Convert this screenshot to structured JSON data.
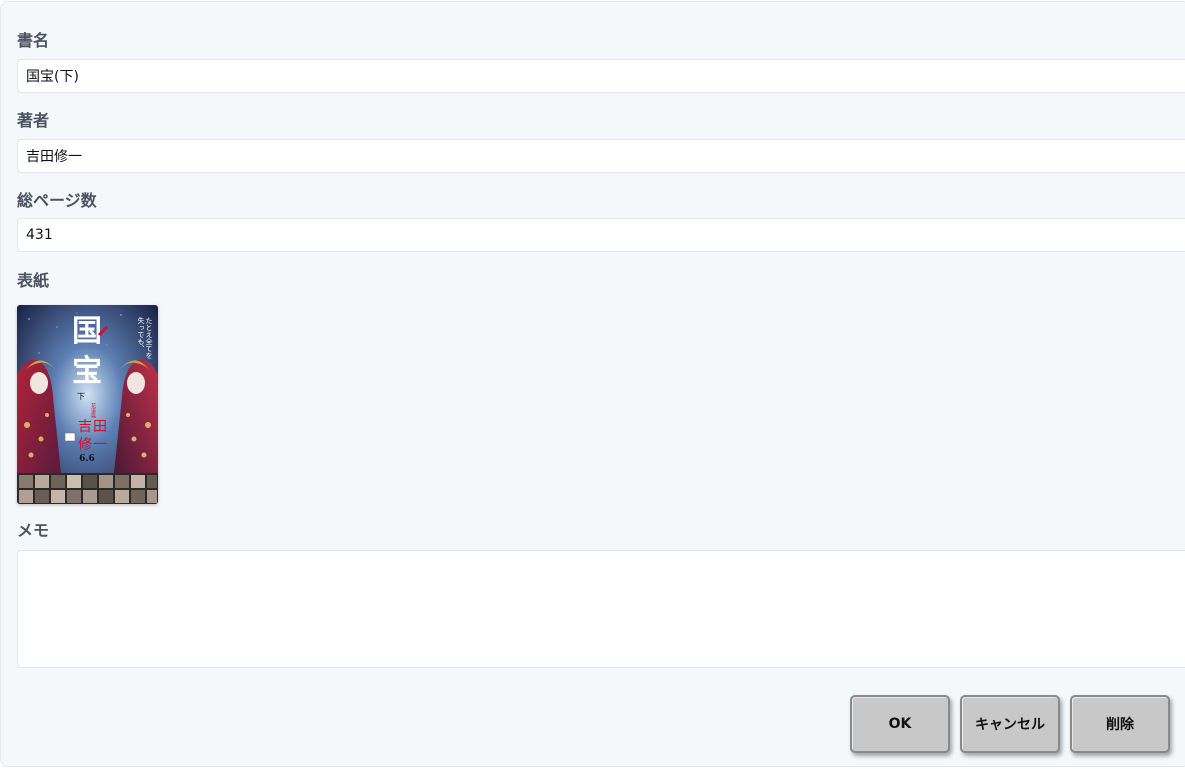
{
  "form": {
    "title_label": "書名",
    "title_value": "国宝(下)",
    "author_label": "著者",
    "author_value": "吉田修一",
    "pages_label": "総ページ数",
    "pages_value": "431",
    "cover_label": "表紙",
    "memo_label": "メモ",
    "memo_value": ""
  },
  "cover": {
    "title_chars": [
      "国",
      "宝"
    ],
    "volume": "下",
    "subtitle": "花道篇",
    "author_chars": [
      "吉",
      "田",
      "修",
      "一"
    ],
    "tagline_right": "たとえ全てを",
    "tagline_right2": "失っても、",
    "date": "6.6"
  },
  "actions": {
    "ok_label": "OK",
    "cancel_label": "キャンセル",
    "delete_label": "削除"
  },
  "colors": {
    "panel_bg": "#f5f8fb",
    "label_text": "#4a5360",
    "button_bg": "#c8c8c8",
    "cover_accent": "#d0112b"
  }
}
